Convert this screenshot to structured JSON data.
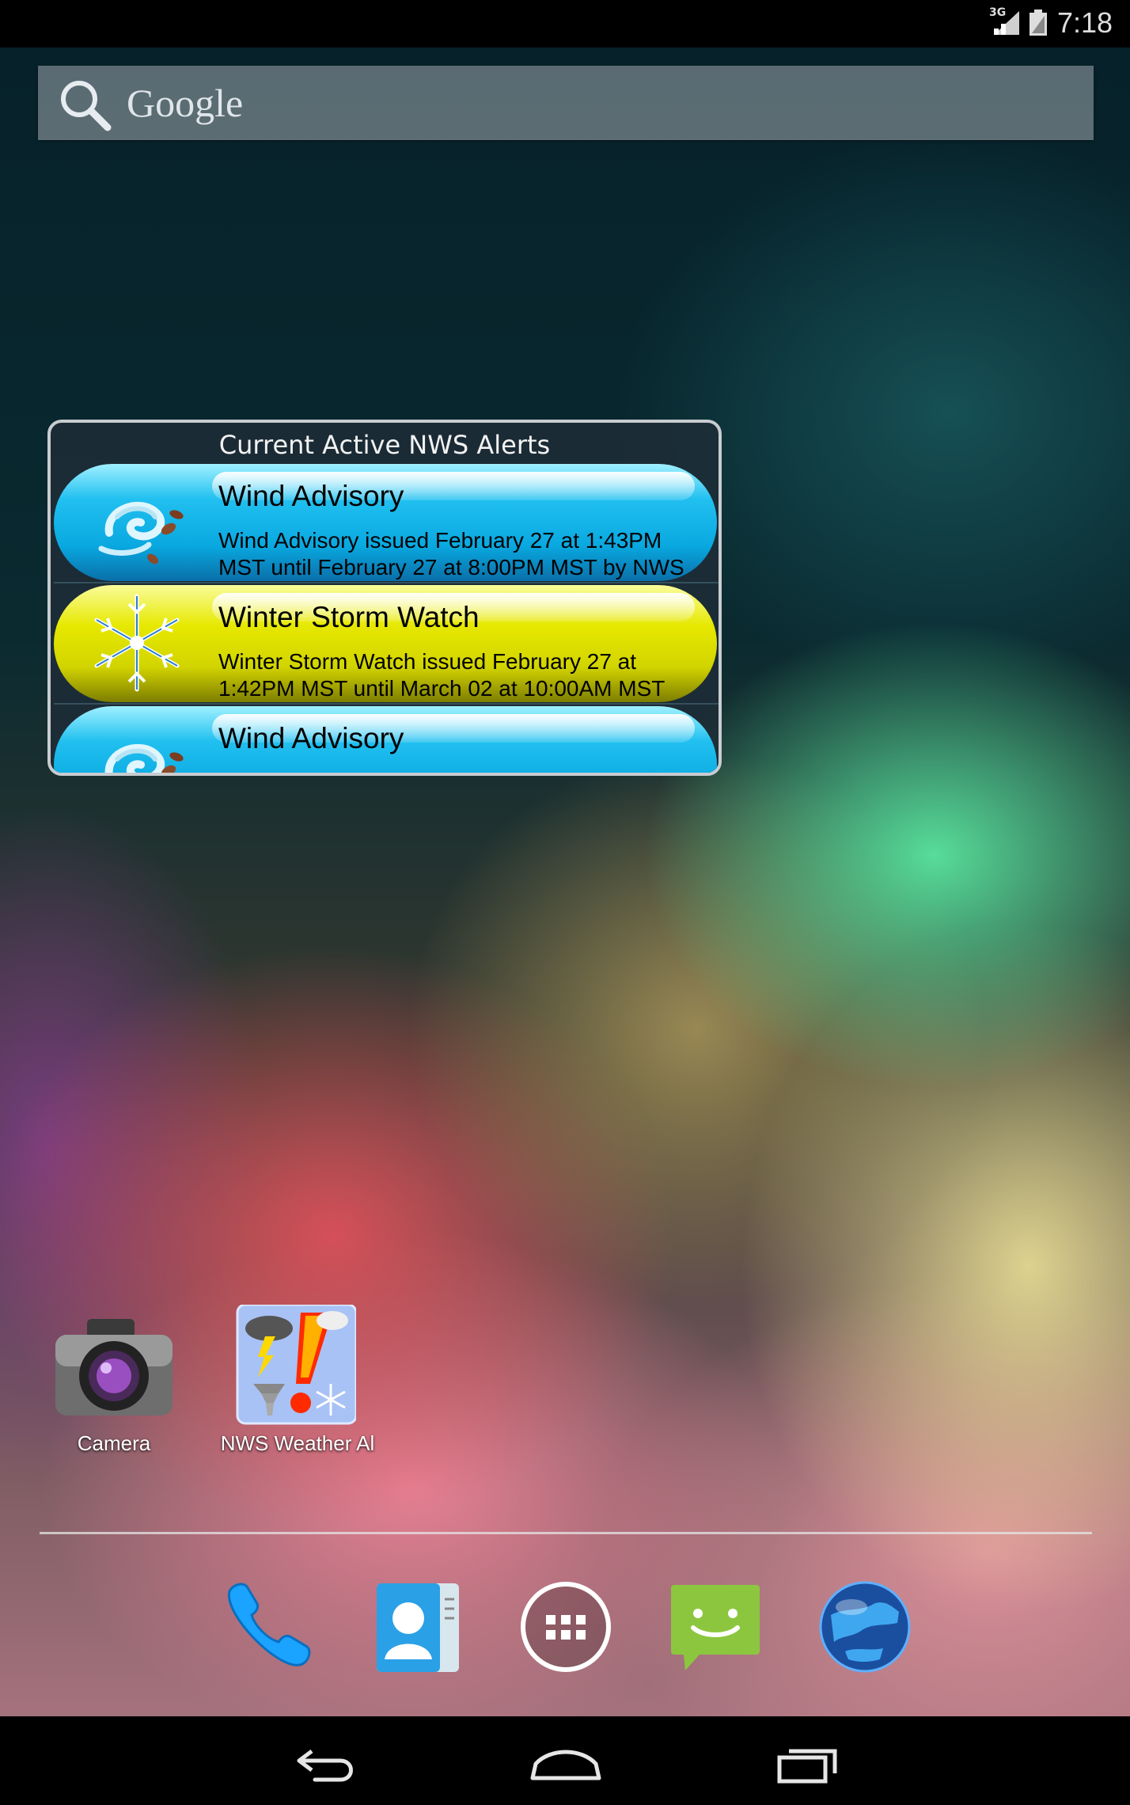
{
  "status_bar": {
    "network": "3G",
    "time": "7:18",
    "icons": [
      "signal-icon",
      "battery-icon"
    ]
  },
  "search": {
    "label": "Google",
    "icon": "search-icon"
  },
  "widget": {
    "title": "Current Active NWS Alerts",
    "alerts": [
      {
        "title": "Wind Advisory",
        "description": "Wind Advisory issued February 27 at 1:43PM MST until February 27 at 8:00PM MST by NWS",
        "color": "#0aa8e0",
        "icon": "wind-icon"
      },
      {
        "title": "Winter Storm Watch",
        "description": "Winter Storm Watch issued February 27 at 1:42PM MST until March 02 at 10:00AM MST",
        "color": "#dcdc00",
        "icon": "snowflake-icon"
      },
      {
        "title": "Wind Advisory",
        "color": "#0aa8e0",
        "icon": "wind-icon"
      }
    ]
  },
  "home_apps": [
    {
      "label": "Camera",
      "icon": "camera-icon"
    },
    {
      "label": "NWS Weather Al",
      "icon": "nws-weather-alert-icon"
    }
  ],
  "dock": [
    "phone-icon",
    "contacts-icon",
    "app-drawer-icon",
    "messaging-icon",
    "browser-icon"
  ],
  "nav": [
    "back-icon",
    "home-icon",
    "recent-apps-icon"
  ]
}
